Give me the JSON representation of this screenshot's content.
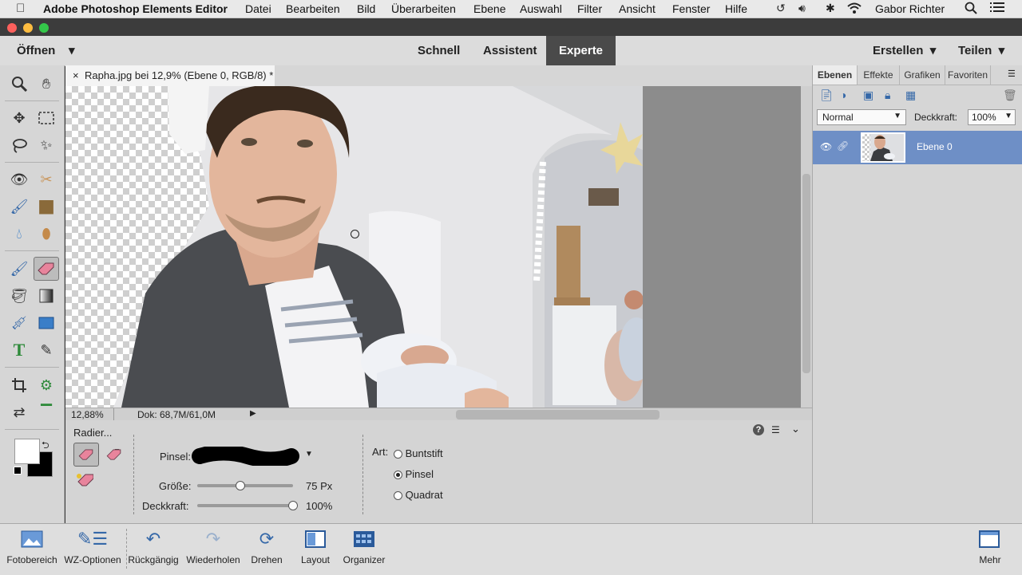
{
  "menubar": {
    "app_name": "Adobe Photoshop Elements Editor",
    "items": [
      "Datei",
      "Bearbeiten",
      "Bild",
      "Überarbeiten",
      "Ebene",
      "Auswahl",
      "Filter",
      "Ansicht",
      "Fenster",
      "Hilfe"
    ],
    "user": "Gabor Richter"
  },
  "header": {
    "open_label": "Öffnen",
    "modes": [
      "Schnell",
      "Assistent",
      "Experte"
    ],
    "active_mode": "Experte",
    "create_label": "Erstellen",
    "share_label": "Teilen"
  },
  "document": {
    "tab_title": "Rapha.jpg bei 12,9% (Ebene 0, RGB/8) *",
    "close_glyph": "×",
    "zoom": "12,88%",
    "doc_info": "Dok: 68,7M/61,0M"
  },
  "tool_options": {
    "tool_name": "Radier...",
    "brush_label": "Pinsel:",
    "size_label": "Größe:",
    "size_value": "75 Px",
    "size_fraction": 0.45,
    "opacity_label": "Deckkraft:",
    "opacity_value": "100%",
    "opacity_fraction": 1.0,
    "type_label": "Art:",
    "types": [
      "Buntstift",
      "Pinsel",
      "Quadrat"
    ],
    "selected_type": "Pinsel"
  },
  "layers_panel": {
    "tabs": [
      "Ebenen",
      "Effekte",
      "Grafiken",
      "Favoriten"
    ],
    "active_tab": "Ebenen",
    "blend_mode": "Normal",
    "opacity_label": "Deckkraft:",
    "opacity_value": "100%",
    "layers": [
      {
        "name": "Ebene 0",
        "selected": true
      }
    ]
  },
  "bottombar": {
    "items": [
      "Fotobereich",
      "WZ-Optionen",
      "Rückgängig",
      "Wiederholen",
      "Drehen",
      "Layout",
      "Organizer"
    ],
    "more_label": "Mehr"
  },
  "colors": {
    "accent": "#5b7fb8",
    "layer_selected": "#6e8fc6"
  }
}
